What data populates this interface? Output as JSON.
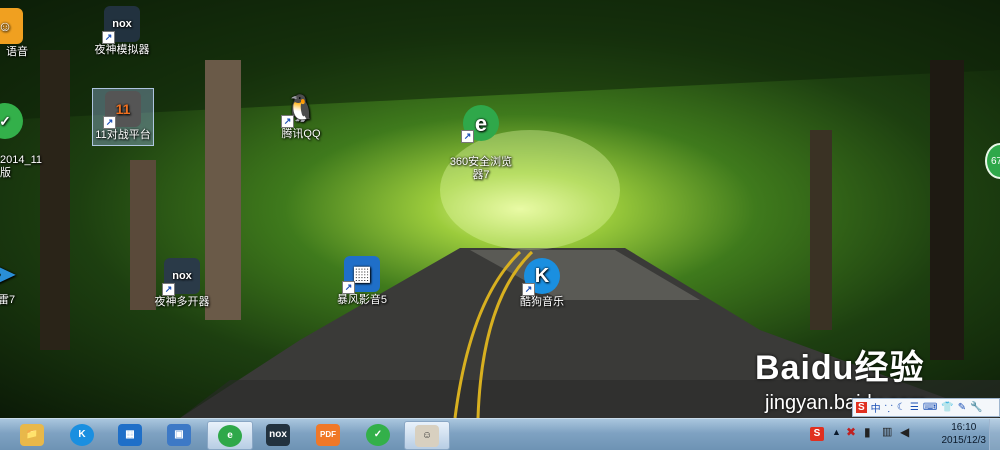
{
  "desktop_icons": [
    {
      "id": "icon-yuyin",
      "label": "语音",
      "color": "#f0a020",
      "glyph": "☺"
    },
    {
      "id": "icon-nox-emulator",
      "label": "夜神模拟器",
      "color": "#22323f",
      "glyph": "nox"
    },
    {
      "id": "icon-2014-edition",
      "label": "2014_11\n版",
      "color": "#33b04a",
      "glyph": "✓"
    },
    {
      "id": "icon-11-platform",
      "label": "11对战平台",
      "color": "#444444",
      "glyph": "11"
    },
    {
      "id": "icon-tencent-qq",
      "label": "腾讯QQ",
      "color": "#111111",
      "glyph": "🐧"
    },
    {
      "id": "icon-360-browser",
      "label": "360安全浏览\n器7",
      "color": "#2fa84a",
      "glyph": "e"
    },
    {
      "id": "icon-lei7",
      "label": "雷7",
      "color": "#2a8fd8",
      "glyph": "➤"
    },
    {
      "id": "icon-nox-multi",
      "label": "夜神多开器",
      "color": "#2a3a48",
      "glyph": "nox"
    },
    {
      "id": "icon-baofeng",
      "label": "暴风影音5",
      "color": "#1f6fc8",
      "glyph": "▦"
    },
    {
      "id": "icon-kugou",
      "label": "酷狗音乐",
      "color": "#1a8fe0",
      "glyph": "K"
    }
  ],
  "right_edge_badge": "67",
  "watermark": {
    "logo": "Baidu经验",
    "url": "jingyan.baidu.com"
  },
  "ime_toolbar": {
    "items": [
      "S",
      "中",
      "⸪",
      "☾",
      "☰",
      "⌨",
      "👕",
      "✎",
      "🔧"
    ]
  },
  "taskbar": {
    "buttons": [
      {
        "id": "explorer",
        "glyph": "📁",
        "color": "#e8b84a"
      },
      {
        "id": "kugou",
        "glyph": "K",
        "color": "#1a8fe0"
      },
      {
        "id": "baofeng",
        "glyph": "▦",
        "color": "#1f6fc8"
      },
      {
        "id": "imagetool",
        "glyph": "▣",
        "color": "#3d79c6"
      },
      {
        "id": "360browser",
        "glyph": "e",
        "color": "#2fa84a"
      },
      {
        "id": "nox",
        "glyph": "nox",
        "color": "#22323f"
      },
      {
        "id": "pdf",
        "glyph": "PDF",
        "color": "#f07828"
      },
      {
        "id": "app-green",
        "glyph": "✓",
        "color": "#33b04a"
      },
      {
        "id": "photo",
        "glyph": "☺",
        "color": "#d8d0c0"
      }
    ]
  },
  "tray": {
    "time": "16:10",
    "date": "2015/12/3"
  }
}
